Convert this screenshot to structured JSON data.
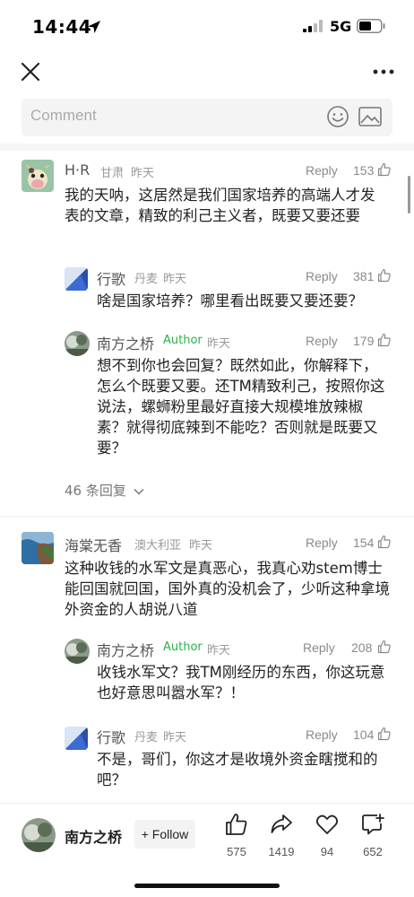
{
  "status": {
    "time": "14:44",
    "network": "5G"
  },
  "comment_input": {
    "placeholder": "Comment"
  },
  "comments": [
    {
      "name": "H·R",
      "location": "甘肃",
      "time": "昨天",
      "reply": "Reply",
      "likes": "153",
      "text": "我的天呐，这居然是我们国家培养的高端人才发表的文章，精致的利己主义者，既要又要还要",
      "replies": [
        {
          "name": "行歌",
          "location": "丹麦",
          "time": "昨天",
          "reply": "Reply",
          "likes": "381",
          "text": "啥是国家培养？哪里看出既要又要还要？"
        },
        {
          "name": "南方之桥",
          "tag": "Author",
          "time": "昨天",
          "reply": "Reply",
          "likes": "179",
          "text": "想不到你也会回复？既然如此，你解释下，怎么个既要又要。还TM精致利己，按照你这说法，螺蛳粉里最好直接大规模堆放辣椒素？就得彻底辣到不能吃？否则就是既要又要？"
        }
      ],
      "more_replies": "46 条回复"
    },
    {
      "name": "海棠无香",
      "location": "澳大利亚",
      "time": "昨天",
      "reply": "Reply",
      "likes": "154",
      "text": "这种收钱的水军文是真恶心，我真心劝stem博士能回国就回国，国外真的没机会了，少听这种拿境外资金的人胡说八道",
      "replies": [
        {
          "name": "南方之桥",
          "tag": "Author",
          "time": "昨天",
          "reply": "Reply",
          "likes": "208",
          "text": "收钱水军文？我TM刚经历的东西，你这玩意也好意思叫嚣水军？！"
        },
        {
          "name": "行歌",
          "location": "丹麦",
          "time": "昨天",
          "reply": "Reply",
          "likes": "104",
          "text": "不是，哥们，你这才是收境外资金瞎搅和的吧？"
        }
      ]
    }
  ],
  "bottom_bar": {
    "author_name": "南方之桥",
    "follow_label": "+ Follow",
    "likes": "575",
    "shares": "1419",
    "favorites": "94",
    "comments": "652"
  },
  "colors": {
    "author_tag": "#2bb24c",
    "meta": "#9a9a9a"
  }
}
